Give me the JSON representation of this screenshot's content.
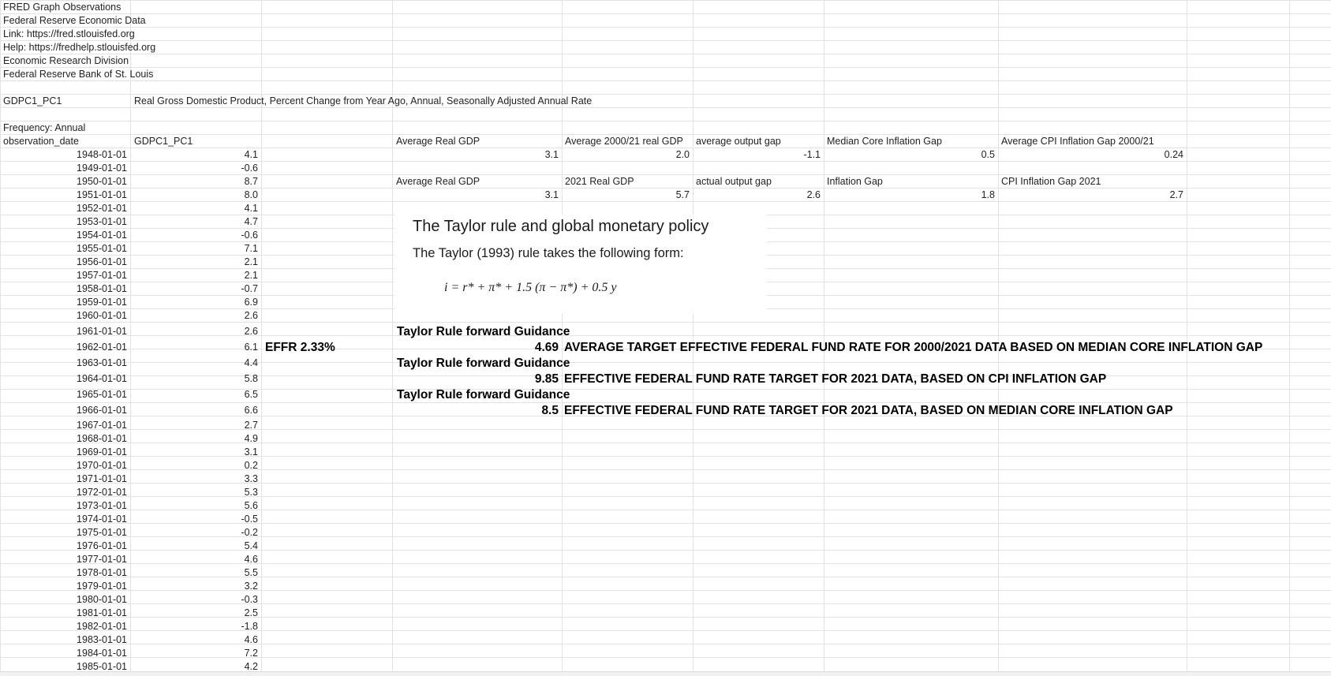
{
  "header": {
    "line1": "FRED Graph Observations",
    "line2": "Federal Reserve Economic Data",
    "line3": "Link: https://fred.stlouisfed.org",
    "line4": "Help: https://fredhelp.stlouisfed.org",
    "line5": "Economic Research Division",
    "line6": "Federal Reserve Bank of St. Louis"
  },
  "series": {
    "id": "GDPC1_PC1",
    "description": "Real Gross Domestic Product, Percent Change from Year Ago, Annual, Seasonally Adjusted Annual Rate",
    "frequency": "Frequency: Annual",
    "col_date": "observation_date",
    "col_value": "GDPC1_PC1"
  },
  "observations": [
    {
      "date": "1948-01-01",
      "value": "4.1"
    },
    {
      "date": "1949-01-01",
      "value": "-0.6"
    },
    {
      "date": "1950-01-01",
      "value": "8.7"
    },
    {
      "date": "1951-01-01",
      "value": "8.0"
    },
    {
      "date": "1952-01-01",
      "value": "4.1"
    },
    {
      "date": "1953-01-01",
      "value": "4.7"
    },
    {
      "date": "1954-01-01",
      "value": "-0.6"
    },
    {
      "date": "1955-01-01",
      "value": "7.1"
    },
    {
      "date": "1956-01-01",
      "value": "2.1"
    },
    {
      "date": "1957-01-01",
      "value": "2.1"
    },
    {
      "date": "1958-01-01",
      "value": "-0.7"
    },
    {
      "date": "1959-01-01",
      "value": "6.9"
    },
    {
      "date": "1960-01-01",
      "value": "2.6"
    },
    {
      "date": "1961-01-01",
      "value": "2.6"
    },
    {
      "date": "1962-01-01",
      "value": "6.1"
    },
    {
      "date": "1963-01-01",
      "value": "4.4"
    },
    {
      "date": "1964-01-01",
      "value": "5.8"
    },
    {
      "date": "1965-01-01",
      "value": "6.5"
    },
    {
      "date": "1966-01-01",
      "value": "6.6"
    },
    {
      "date": "1967-01-01",
      "value": "2.7"
    },
    {
      "date": "1968-01-01",
      "value": "4.9"
    },
    {
      "date": "1969-01-01",
      "value": "3.1"
    },
    {
      "date": "1970-01-01",
      "value": "0.2"
    },
    {
      "date": "1971-01-01",
      "value": "3.3"
    },
    {
      "date": "1972-01-01",
      "value": "5.3"
    },
    {
      "date": "1973-01-01",
      "value": "5.6"
    },
    {
      "date": "1974-01-01",
      "value": "-0.5"
    },
    {
      "date": "1975-01-01",
      "value": "-0.2"
    },
    {
      "date": "1976-01-01",
      "value": "5.4"
    },
    {
      "date": "1977-01-01",
      "value": "4.6"
    },
    {
      "date": "1978-01-01",
      "value": "5.5"
    },
    {
      "date": "1979-01-01",
      "value": "3.2"
    },
    {
      "date": "1980-01-01",
      "value": "-0.3"
    },
    {
      "date": "1981-01-01",
      "value": "2.5"
    },
    {
      "date": "1982-01-01",
      "value": "-1.8"
    },
    {
      "date": "1983-01-01",
      "value": "4.6"
    },
    {
      "date": "1984-01-01",
      "value": "7.2"
    },
    {
      "date": "1985-01-01",
      "value": "4.2"
    }
  ],
  "stats": {
    "row1_labels": [
      "Average Real GDP",
      "Average 2000/21 real GDP",
      "average output gap",
      "Median Core Inflation Gap",
      "Average CPI Inflation Gap 2000/21"
    ],
    "row1_values": [
      "3.1",
      "2.0",
      "-1.1",
      "0.5",
      "0.24"
    ],
    "row2_labels": [
      "Average Real GDP",
      "2021 Real GDP",
      "actual output gap",
      "Inflation Gap",
      "CPI Inflation Gap 2021"
    ],
    "row2_values": [
      "3.1",
      "5.7",
      "2.6",
      "1.8",
      "2.7"
    ]
  },
  "taylor": {
    "title": "The Taylor rule and global monetary policy",
    "subtitle": "The Taylor (1993) rule takes the following form:",
    "formula": "i = r* + π* + 1.5 (π − π*) + 0.5 y"
  },
  "guidance": {
    "effr": "EFFR 2.33%",
    "items": [
      {
        "heading": "Taylor Rule forward Guidance",
        "value": "4.69",
        "text": "AVERAGE TARGET EFFECTIVE FEDERAL FUND RATE FOR 2000/2021 DATA BASED ON MEDIAN CORE INFLATION GAP"
      },
      {
        "heading": "Taylor Rule forward Guidance",
        "value": "9.85",
        "text": "EFFECTIVE FEDERAL FUND RATE TARGET FOR 2021 DATA, BASED ON CPI INFLATION GAP"
      },
      {
        "heading": "Taylor Rule forward Guidance",
        "value": "8.5",
        "text": "EFFECTIVE FEDERAL FUND RATE TARGET FOR 2021 DATA, BASED ON MEDIAN CORE INFLATION GAP"
      }
    ]
  }
}
